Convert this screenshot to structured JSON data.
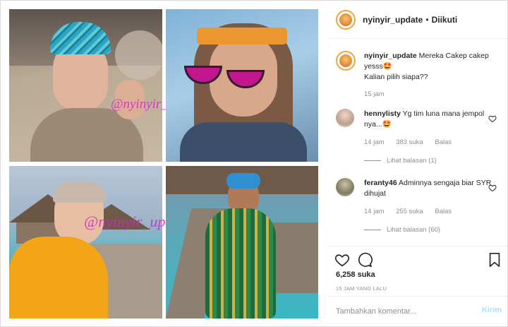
{
  "header": {
    "username": "nyinyir_update",
    "separator": "•",
    "follow_state": "Diikuti"
  },
  "photos": {
    "watermark_top_left": "@nyinyir_update",
    "watermark_bottom": "@nyinyir_update"
  },
  "caption": {
    "username": "nyinyir_update",
    "text_line1": "Mereka Cakep cakep yesss🤩",
    "text_line2": "Kalian pilih siapa??",
    "time": "15 jam"
  },
  "comments": [
    {
      "username": "hennylisty",
      "text": "Yg tim luna mana jempol nya...🤩",
      "time": "14 jam",
      "likes": "383 suka",
      "reply_label": "Balas",
      "view_replies": "Lihat balasan (1)"
    },
    {
      "username": "feranty46",
      "text": "Adminnya sengaja biar SYR dihujat",
      "time": "14 jam",
      "likes": "255 suka",
      "reply_label": "Balas",
      "view_replies": "Lihat balasan (60)"
    }
  ],
  "actions": {
    "likes_count": "6,258 suka",
    "timestamp": "15 JAM YANG LALU"
  },
  "add_comment": {
    "placeholder": "Tambahkan komentar...",
    "post_label": "Kirim"
  },
  "colors": {
    "watermark": "#d228c8",
    "post_button_disabled": "#b2dffc",
    "secondary_text": "#8e8e8e"
  }
}
